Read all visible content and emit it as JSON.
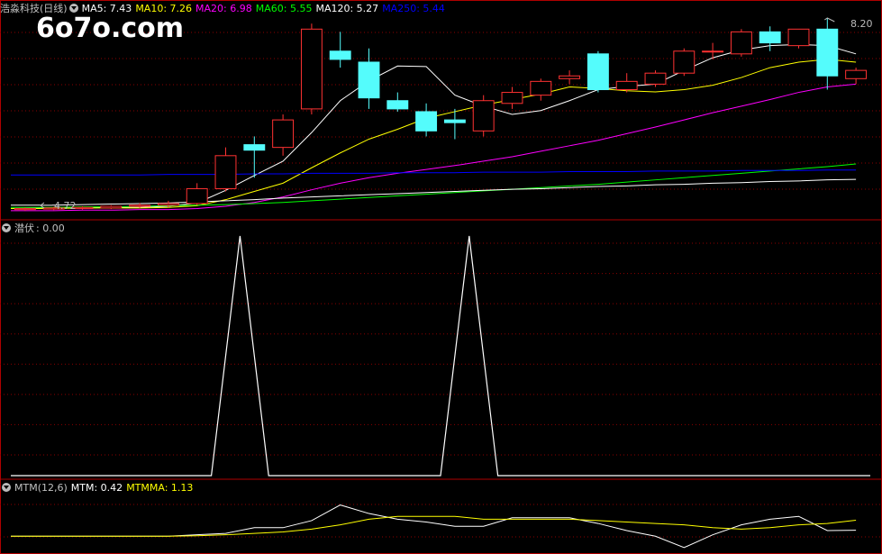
{
  "watermark": "6o7o.com",
  "main_header": {
    "title": "浩淼科技(日线)",
    "indicators": [
      {
        "label": "MA5: 7.43",
        "color": "#ffffff"
      },
      {
        "label": "MA10: 7.26",
        "color": "#ffff00"
      },
      {
        "label": "MA20: 6.98",
        "color": "#ff00ff"
      },
      {
        "label": "MA60: 5.55",
        "color": "#00ff00"
      },
      {
        "label": "MA120: 5.27",
        "color": "#ffffff"
      },
      {
        "label": "MA250: 5.44",
        "color": "#0000ff"
      }
    ],
    "high_label": "8.20",
    "low_label": "4.72"
  },
  "sub1_header": {
    "title": "潜伏",
    "value": ": 0.00"
  },
  "sub2_header": {
    "title": "MTM(12,6)",
    "mtm_label": "MTM: 0.42",
    "mtmma_label": "MTMMA: 1.13"
  },
  "colors": {
    "up": "#ff3232",
    "down": "#54fcfc",
    "grid": "#8b0000",
    "border": "#b00000"
  },
  "chart_data": [
    {
      "type": "candlestick",
      "title": "浩淼科技(日线)",
      "ylim": [
        4.6,
        8.3
      ],
      "candles": [
        {
          "o": 4.72,
          "h": 4.76,
          "l": 4.7,
          "c": 4.74
        },
        {
          "o": 4.73,
          "h": 4.77,
          "l": 4.71,
          "c": 4.75
        },
        {
          "o": 4.74,
          "h": 4.78,
          "l": 4.72,
          "c": 4.76
        },
        {
          "o": 4.75,
          "h": 4.8,
          "l": 4.73,
          "c": 4.78
        },
        {
          "o": 4.78,
          "h": 4.84,
          "l": 4.75,
          "c": 4.8
        },
        {
          "o": 4.8,
          "h": 4.88,
          "l": 4.76,
          "c": 4.83
        },
        {
          "o": 4.83,
          "h": 5.2,
          "l": 4.8,
          "c": 5.1
        },
        {
          "o": 5.1,
          "h": 5.85,
          "l": 5.05,
          "c": 5.7
        },
        {
          "o": 5.9,
          "h": 6.05,
          "l": 5.3,
          "c": 5.8
        },
        {
          "o": 5.85,
          "h": 6.45,
          "l": 5.7,
          "c": 6.35
        },
        {
          "o": 6.55,
          "h": 8.1,
          "l": 6.45,
          "c": 8.0
        },
        {
          "o": 7.6,
          "h": 7.95,
          "l": 7.3,
          "c": 7.45
        },
        {
          "o": 7.4,
          "h": 7.65,
          "l": 6.55,
          "c": 6.75
        },
        {
          "o": 6.7,
          "h": 6.85,
          "l": 6.5,
          "c": 6.55
        },
        {
          "o": 6.5,
          "h": 6.65,
          "l": 6.05,
          "c": 6.15
        },
        {
          "o": 6.35,
          "h": 6.55,
          "l": 6.0,
          "c": 6.3
        },
        {
          "o": 6.15,
          "h": 6.8,
          "l": 6.05,
          "c": 6.7
        },
        {
          "o": 6.65,
          "h": 6.95,
          "l": 6.55,
          "c": 6.85
        },
        {
          "o": 6.8,
          "h": 7.1,
          "l": 6.7,
          "c": 7.05
        },
        {
          "o": 7.1,
          "h": 7.25,
          "l": 7.0,
          "c": 7.15
        },
        {
          "o": 7.55,
          "h": 7.6,
          "l": 6.85,
          "c": 6.9
        },
        {
          "o": 6.9,
          "h": 7.2,
          "l": 6.85,
          "c": 7.05
        },
        {
          "o": 7.0,
          "h": 7.25,
          "l": 6.95,
          "c": 7.2
        },
        {
          "o": 7.2,
          "h": 7.65,
          "l": 7.15,
          "c": 7.6
        },
        {
          "o": 7.6,
          "h": 7.75,
          "l": 7.45,
          "c": 7.6
        },
        {
          "o": 7.55,
          "h": 8.0,
          "l": 7.5,
          "c": 7.95
        },
        {
          "o": 7.95,
          "h": 8.05,
          "l": 7.6,
          "c": 7.75
        },
        {
          "o": 7.7,
          "h": 8.0,
          "l": 7.65,
          "c": 8.0
        },
        {
          "o": 8.0,
          "h": 8.2,
          "l": 6.9,
          "c": 7.15
        },
        {
          "o": 7.1,
          "h": 7.3,
          "l": 7.0,
          "c": 7.25
        }
      ],
      "ma": [
        {
          "name": "MA5",
          "color": "#ffffff",
          "values": [
            4.74,
            4.75,
            4.75,
            4.76,
            4.76,
            4.78,
            4.84,
            5.07,
            5.34,
            5.6,
            6.12,
            6.7,
            7.06,
            7.33,
            7.32,
            6.8,
            6.6,
            6.45,
            6.52,
            6.7,
            6.9,
            6.96,
            7.0,
            7.25,
            7.48,
            7.62,
            7.7,
            7.72,
            7.7,
            7.55
          ]
        },
        {
          "name": "MA10",
          "color": "#ffff00",
          "values": [
            4.74,
            4.74,
            4.75,
            4.75,
            4.75,
            4.76,
            4.79,
            4.9,
            5.05,
            5.2,
            5.48,
            5.75,
            6.0,
            6.18,
            6.38,
            6.5,
            6.62,
            6.72,
            6.82,
            6.95,
            6.92,
            6.88,
            6.86,
            6.9,
            6.98,
            7.12,
            7.3,
            7.4,
            7.45,
            7.4
          ]
        },
        {
          "name": "MA20",
          "color": "#ff00ff",
          "values": [
            4.7,
            4.7,
            4.71,
            4.71,
            4.72,
            4.72,
            4.74,
            4.78,
            4.85,
            4.95,
            5.08,
            5.2,
            5.3,
            5.38,
            5.45,
            5.52,
            5.6,
            5.68,
            5.78,
            5.88,
            5.98,
            6.1,
            6.22,
            6.35,
            6.48,
            6.6,
            6.72,
            6.85,
            6.95,
            7.0
          ]
        },
        {
          "name": "MA60",
          "color": "#00ff00",
          "values": [
            4.76,
            4.76,
            4.77,
            4.77,
            4.78,
            4.79,
            4.8,
            4.81,
            4.83,
            4.85,
            4.88,
            4.91,
            4.94,
            4.97,
            5.0,
            5.03,
            5.06,
            5.09,
            5.12,
            5.15,
            5.18,
            5.22,
            5.26,
            5.3,
            5.34,
            5.38,
            5.42,
            5.46,
            5.5,
            5.55
          ]
        },
        {
          "name": "MA120",
          "color": "#ffffff",
          "values": [
            4.8,
            4.8,
            4.81,
            4.82,
            4.83,
            4.84,
            4.86,
            4.88,
            4.9,
            4.93,
            4.95,
            4.97,
            4.99,
            5.01,
            5.03,
            5.05,
            5.07,
            5.09,
            5.1,
            5.12,
            5.14,
            5.15,
            5.17,
            5.18,
            5.2,
            5.21,
            5.23,
            5.24,
            5.26,
            5.27
          ]
        },
        {
          "name": "MA250",
          "color": "#0000ff",
          "values": [
            5.35,
            5.35,
            5.35,
            5.35,
            5.35,
            5.36,
            5.36,
            5.36,
            5.37,
            5.37,
            5.38,
            5.38,
            5.38,
            5.39,
            5.39,
            5.39,
            5.4,
            5.4,
            5.4,
            5.41,
            5.41,
            5.41,
            5.42,
            5.42,
            5.42,
            5.43,
            5.43,
            5.43,
            5.44,
            5.44
          ]
        }
      ]
    },
    {
      "type": "line",
      "title": "潜伏",
      "ylim": [
        0,
        1
      ],
      "x": [
        0,
        6.5,
        7.5,
        8.5,
        14.5,
        15.5,
        16.5,
        29.5
      ],
      "values": [
        0,
        0,
        1,
        0,
        0,
        1,
        0,
        0
      ]
    },
    {
      "type": "line",
      "title": "MTM(12,6)",
      "ylim": [
        -1,
        3
      ],
      "series": [
        {
          "name": "MTM",
          "color": "#ffffff",
          "values": [
            0,
            0,
            0,
            0,
            0,
            0,
            0.1,
            0.2,
            0.6,
            0.6,
            1.1,
            2.2,
            1.6,
            1.2,
            1.0,
            0.7,
            0.7,
            1.3,
            1.3,
            1.3,
            0.9,
            0.4,
            0.0,
            -0.8,
            0.1,
            0.8,
            1.2,
            1.4,
            0.4,
            0.42
          ]
        },
        {
          "name": "MTMMA",
          "color": "#ffff00",
          "values": [
            0,
            0,
            0,
            0,
            0,
            0,
            0.03,
            0.1,
            0.2,
            0.3,
            0.5,
            0.8,
            1.2,
            1.4,
            1.4,
            1.4,
            1.2,
            1.2,
            1.2,
            1.2,
            1.1,
            1.0,
            0.9,
            0.8,
            0.6,
            0.5,
            0.6,
            0.8,
            0.9,
            1.13
          ]
        }
      ]
    }
  ]
}
